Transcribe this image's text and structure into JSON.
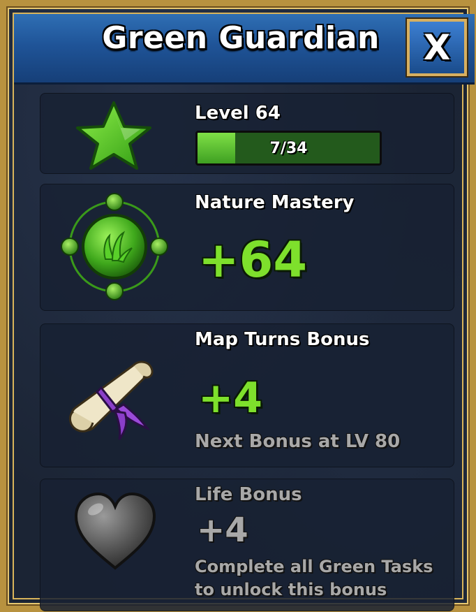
{
  "window": {
    "title": "Green Guardian",
    "close_label": "X"
  },
  "level": {
    "label": "Level 64",
    "progress_text": "7/34",
    "progress_fraction": 0.206
  },
  "mastery": {
    "label": "Nature Mastery",
    "value": "+64"
  },
  "map_turns": {
    "label": "Map Turns Bonus",
    "value": "+4",
    "next_bonus": "Next Bonus at LV 80"
  },
  "life": {
    "label": "Life Bonus",
    "value": "+4",
    "requirement": "Complete all Green Tasks to unlock this bonus"
  },
  "colors": {
    "accent_green": "#7ee02c",
    "header_blue": "#1f5498",
    "frame_gold": "#b8923f",
    "locked_grey": "#a8a8a8"
  },
  "icons": [
    "star-icon",
    "nature-orb-icon",
    "scroll-icon",
    "heart-icon",
    "close-icon"
  ]
}
